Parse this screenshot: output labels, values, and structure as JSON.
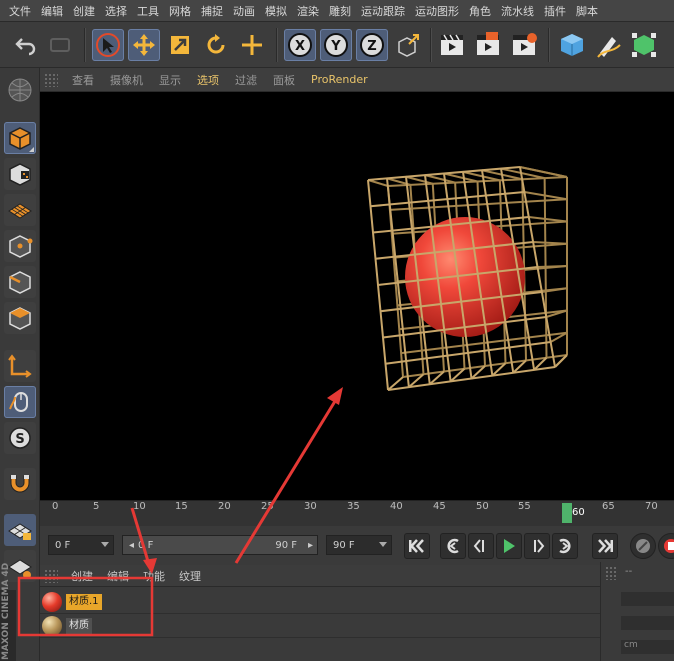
{
  "menubar": {
    "items": [
      "文件",
      "编辑",
      "创建",
      "选择",
      "工具",
      "网格",
      "捕捉",
      "动画",
      "模拟",
      "渲染",
      "雕刻",
      "运动跟踪",
      "运动图形",
      "角色",
      "流水线",
      "插件",
      "脚本"
    ]
  },
  "toolbar": {
    "icons": [
      "undo-icon",
      "redo-icon",
      "select-arrow-icon",
      "move-icon",
      "scale-icon",
      "rotate-icon",
      "transform-icon",
      "x-axis-icon",
      "y-axis-icon",
      "z-axis-icon",
      "coordinate-system-icon",
      "render-view-icon",
      "render-picture-viewer-icon",
      "render-settings-icon",
      "cube-icon",
      "pen-icon",
      "subdivision-icon"
    ],
    "axis_labels": [
      "X",
      "Y",
      "Z"
    ]
  },
  "viewport_menu": {
    "items": [
      "查看",
      "摄像机",
      "显示",
      "选项",
      "过滤",
      "面板",
      "ProRender"
    ],
    "selected": "选项"
  },
  "timeline": {
    "ticks": [
      "0",
      "5",
      "10",
      "15",
      "20",
      "25",
      "30",
      "35",
      "40",
      "45",
      "50",
      "55",
      "60",
      "65",
      "70"
    ],
    "current_frame": "60"
  },
  "transport": {
    "start_frame": "0 F",
    "slider_start": "0 F",
    "slider_end": "90 F",
    "end_frame": "90 F"
  },
  "material_manager": {
    "menu": [
      "创建",
      "编辑",
      "功能",
      "纹理"
    ],
    "materials": [
      {
        "label": "材质.1",
        "selected": true
      },
      {
        "label": "材质",
        "selected": false
      }
    ]
  },
  "right_panel": {
    "top_value": "--",
    "unit_value": "cm"
  },
  "brand": {
    "text": "MAXON CINEMA 4D"
  },
  "colors": {
    "accent": "#e8a62a",
    "active_tool": "#4e5d78",
    "playhead": "#4fb36b",
    "annotation": "#e53935",
    "sphere": "#e53b2a",
    "lattice": "#b9975b"
  }
}
